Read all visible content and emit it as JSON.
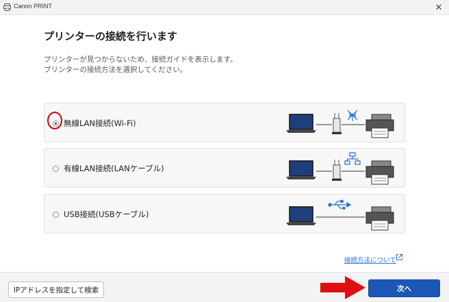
{
  "window": {
    "title": "Canon PRINT",
    "close_glyph": "✕"
  },
  "page": {
    "heading": "プリンターの接続を行います",
    "description_line1": "プリンターが見つからないため、接続ガイドを表示します。",
    "description_line2": "プリンターの接続方法を選択してください。"
  },
  "options": [
    {
      "label": "無線LAN接続(Wi-Fi)",
      "selected": true,
      "icon": "wifi-router-icon"
    },
    {
      "label": "有線LAN接続(LANケーブル)",
      "selected": false,
      "icon": "lan-network-icon"
    },
    {
      "label": "USB接続(USBケーブル)",
      "selected": false,
      "icon": "usb-icon"
    }
  ],
  "help": {
    "link_label": "接続方法について",
    "icon": "external-link-icon"
  },
  "footer": {
    "ip_button_label": "IPアドレスを指定して検索",
    "next_button_label": "次へ"
  },
  "colors": {
    "accent": "#1c57b5",
    "annotation": "#d40000",
    "icon_blue": "#2a6fd6"
  }
}
